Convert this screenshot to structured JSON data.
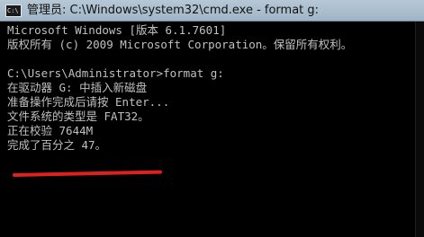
{
  "window": {
    "title": "管理员: C:\\Windows\\system32\\cmd.exe - format  g:",
    "icon_name": "cmd-icon",
    "icon_glyph": "C:\\"
  },
  "console": {
    "lines": [
      "Microsoft Windows [版本 6.1.7601]",
      "版权所有 (c) 2009 Microsoft Corporation。保留所有权利。",
      "",
      "C:\\Users\\Administrator>format g:",
      "在驱动器 G: 中插入新磁盘",
      "准备操作完成后请按 Enter...",
      "文件系统的类型是 FAT32。",
      "正在校验 7644M",
      "完成了百分之 47。",
      ""
    ]
  },
  "colors": {
    "console_background": "#000000",
    "console_text": "#c0c0c0",
    "titlebar": "#a9bccb",
    "annotation_underline": "#e0201e"
  }
}
